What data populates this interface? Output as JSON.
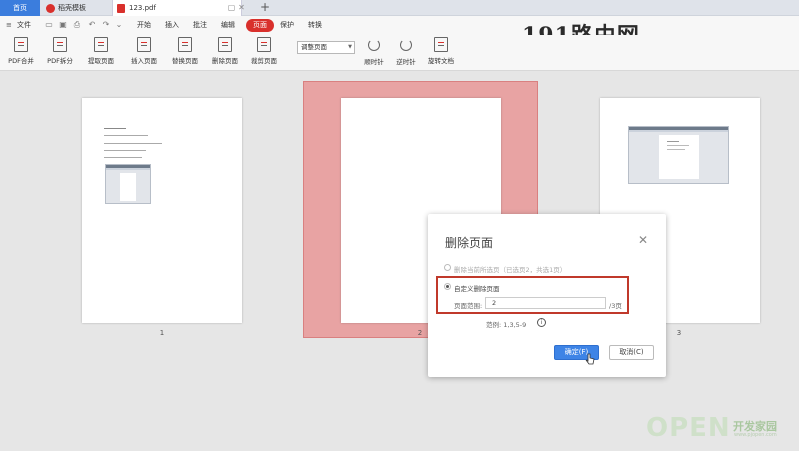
{
  "tabs": [
    {
      "label": "首页"
    },
    {
      "label": "稻壳模板"
    },
    {
      "label": "123.pdf"
    }
  ],
  "tab_controls": {
    "pin": "▢",
    "close": "✕",
    "new_tab": "+"
  },
  "menu": {
    "file_label": "文件",
    "tabs": [
      "开始",
      "插入",
      "批注",
      "编辑",
      "页面",
      "保护",
      "转换"
    ],
    "active_tab": "页面"
  },
  "ribbon": {
    "buttons": [
      "PDF合并",
      "PDF拆分",
      "提取页面",
      "插入页面",
      "替换页面",
      "删除页面",
      "裁剪页面",
      "顺时针",
      "逆时针",
      "旋转文档"
    ],
    "view_select": "调整页面"
  },
  "watermark_top": "191路由网",
  "pages": [
    {
      "number": "1"
    },
    {
      "number": "2"
    },
    {
      "number": "3"
    }
  ],
  "dialog": {
    "title": "删除页面",
    "close": "✕",
    "option_current": "删除当前所选页（已选页2，共选1页）",
    "option_custom": "自定义删除页面",
    "range_label": "页面范围:",
    "range_value": "2",
    "range_suffix": "/3页",
    "example": "范例: 1,3,5-9",
    "info_icon": "i",
    "ok": "确定(F)",
    "cancel": "取消(C)"
  },
  "watermark_bottom": {
    "brand": "OPEN",
    "cn": "开发家园",
    "url": "www.pjopen.com"
  },
  "colors": {
    "accent_red": "#d9302c",
    "primary_blue": "#3e84e6",
    "selection_pink": "#e8a3a3",
    "highlight_red": "#c0392b"
  }
}
